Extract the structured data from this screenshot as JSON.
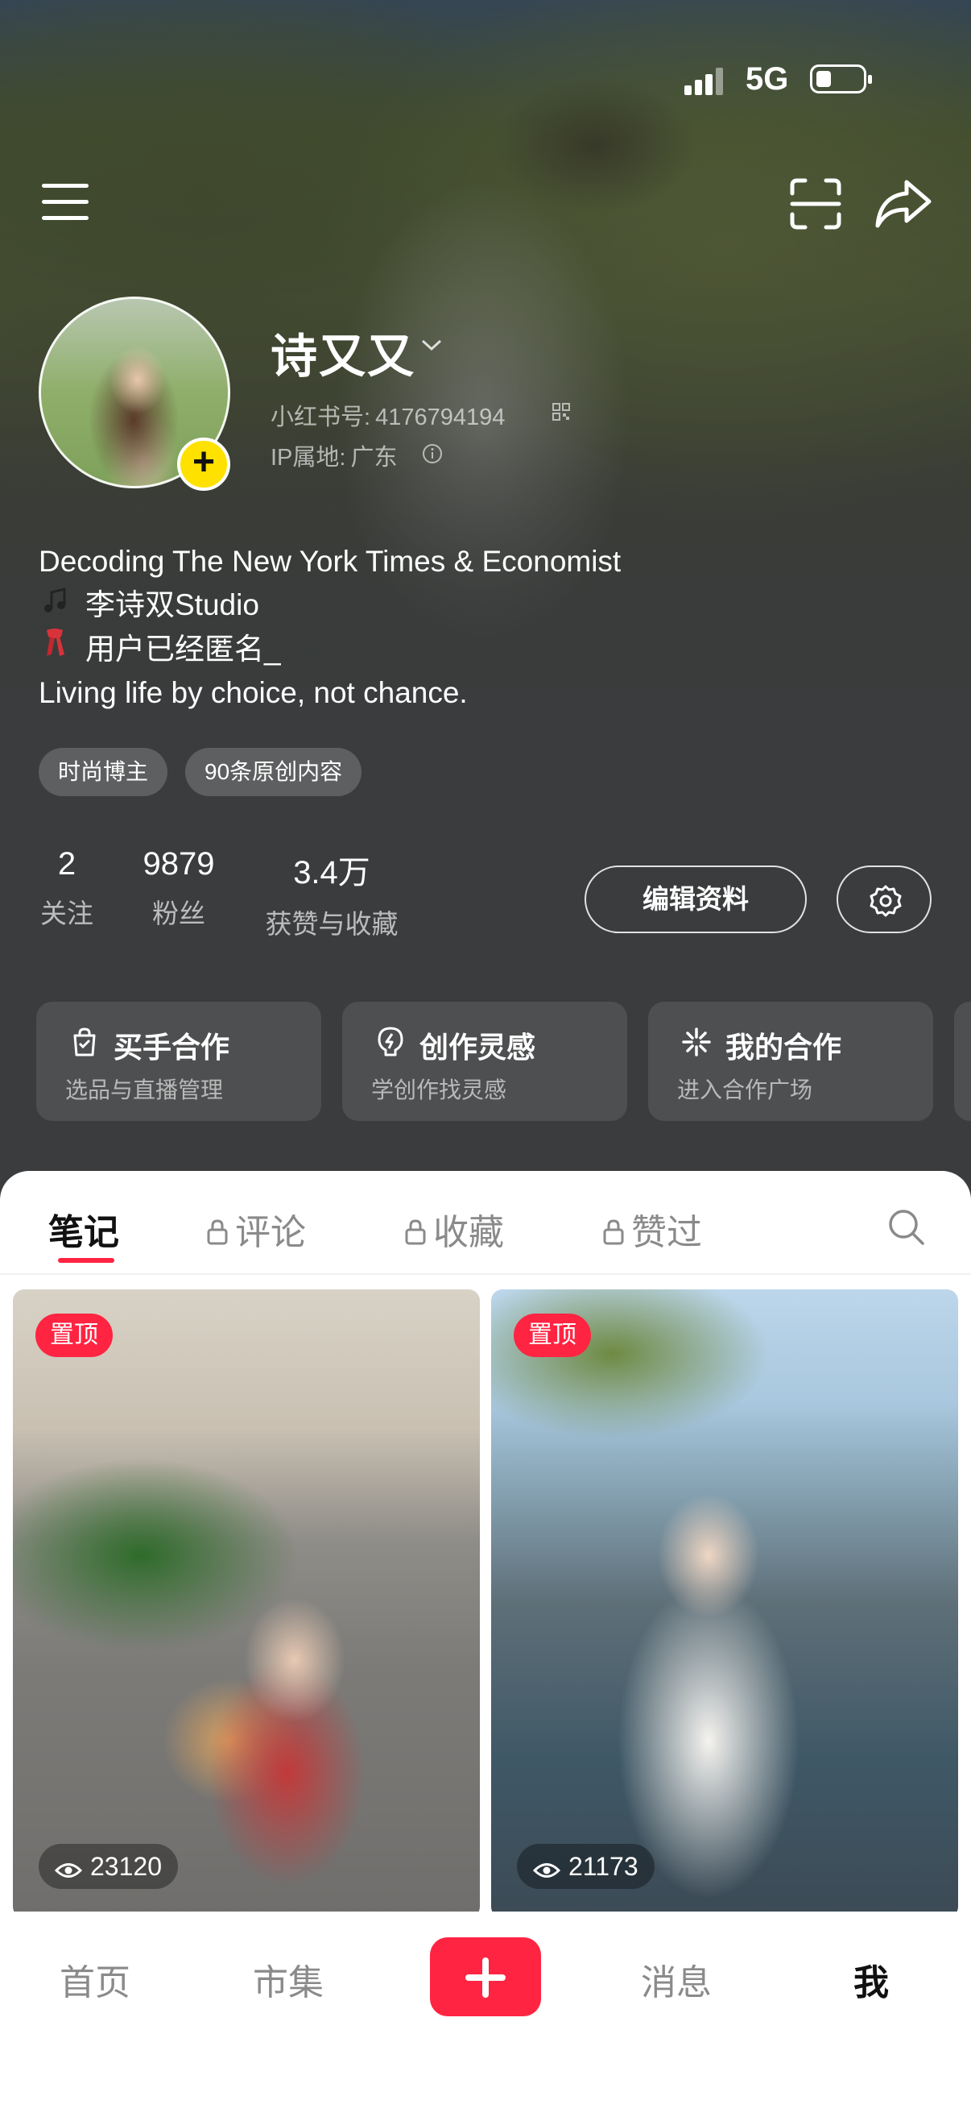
{
  "status_bar": {
    "network": "5G"
  },
  "profile": {
    "name": "诗又又",
    "id_label": "小红书号:",
    "id_value": "4176794194",
    "ip_label": "IP属地:",
    "ip_value": "广东",
    "bio": [
      {
        "icon": "music-note-icon",
        "text": "Decoding The New York Times & Economist"
      },
      {
        "icon": "music-note-icon",
        "text": "李诗双Studio"
      },
      {
        "icon": "scarf-icon",
        "text": "用户已经匿名_"
      },
      {
        "icon": "",
        "text": "Living life by choice, not chance."
      }
    ],
    "tags": [
      "时尚博主",
      "90条原创内容"
    ]
  },
  "stats": [
    {
      "value": "2",
      "label": "关注"
    },
    {
      "value": "9879",
      "label": "粉丝"
    },
    {
      "value": "3.4万",
      "label": "获赞与收藏"
    }
  ],
  "actions": {
    "edit_label": "编辑资料"
  },
  "cards": [
    {
      "icon": "shopping-bag-icon",
      "title": "买手合作",
      "subtitle": "选品与直播管理"
    },
    {
      "icon": "lightbulb-icon",
      "title": "创作灵感",
      "subtitle": "学创作找灵感"
    },
    {
      "icon": "sparkle-icon",
      "title": "我的合作",
      "subtitle": "进入合作广场"
    }
  ],
  "tabs": [
    {
      "label": "笔记",
      "locked": false,
      "active": true
    },
    {
      "label": "评论",
      "locked": true,
      "active": false
    },
    {
      "label": "收藏",
      "locked": true,
      "active": false
    },
    {
      "label": "赞过",
      "locked": true,
      "active": false
    }
  ],
  "notes": [
    {
      "badge": "置顶",
      "views": "23120"
    },
    {
      "badge": "置顶",
      "views": "21173"
    }
  ],
  "bottom_nav": [
    {
      "label": "首页",
      "active": false
    },
    {
      "label": "市集",
      "active": false
    },
    {
      "label": "消息",
      "active": false
    },
    {
      "label": "我",
      "active": true
    }
  ],
  "colors": {
    "accent": "#ff2442",
    "avatar_add": "#ffe100",
    "hero_bg": "#3a3c3d"
  }
}
